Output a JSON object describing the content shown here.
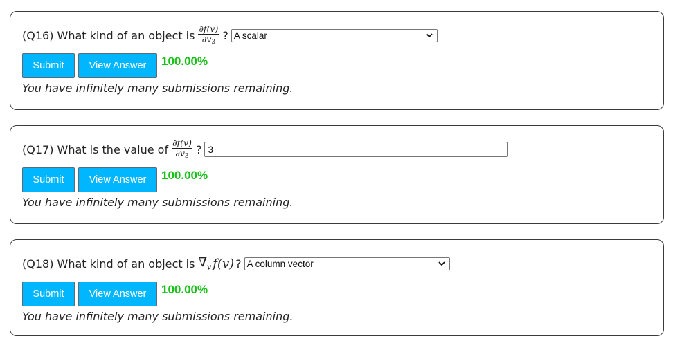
{
  "questions": [
    {
      "number": "(Q16)",
      "text": "What kind of an object is",
      "expr": {
        "num": "∂f(v)",
        "den_base": "∂v",
        "den_sub": "3"
      },
      "qmark": "?",
      "input_type": "select",
      "value": "A scalar",
      "submit_label": "Submit",
      "view_label": "View Answer",
      "score": "100.00%",
      "remaining": "You have infinitely many submissions remaining."
    },
    {
      "number": "(Q17)",
      "text": "What is the value of",
      "expr": {
        "num": "∂f(v)",
        "den_base": "∂v",
        "den_sub": "3"
      },
      "qmark": "?",
      "input_type": "text",
      "value": "3",
      "submit_label": "Submit",
      "view_label": "View Answer",
      "score": "100.00%",
      "remaining": "You have infinitely many submissions remaining."
    },
    {
      "number": "(Q18)",
      "text": "What kind of an object is",
      "expr": {
        "nabla": "∇",
        "nabla_sub": "v",
        "func": "f(v)"
      },
      "qmark": "?",
      "input_type": "select",
      "value": "A column vector",
      "submit_label": "Submit",
      "view_label": "View Answer",
      "score": "100.00%",
      "remaining": "You have infinitely many submissions remaining."
    }
  ],
  "colors": {
    "button_bg": "#00b7ff",
    "score_green": "#18c018",
    "border": "#3a3a3a"
  },
  "icons": {
    "dropdown": "chevron-down-icon"
  }
}
